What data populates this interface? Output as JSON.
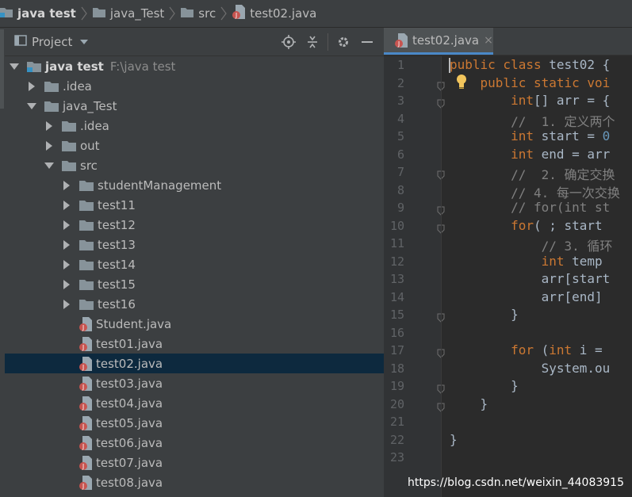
{
  "breadcrumb": {
    "project": "java test",
    "module": "java_Test",
    "folder": "src",
    "file": "test02.java"
  },
  "project_panel": {
    "title": "Project",
    "tree": [
      {
        "label": "java test",
        "hint": "F:\\java test",
        "depth": 0,
        "expanded": true,
        "icon": "project-folder-icon",
        "bold": true
      },
      {
        "label": ".idea",
        "depth": 1,
        "expanded": false,
        "icon": "folder-icon"
      },
      {
        "label": "java_Test",
        "depth": 1,
        "expanded": true,
        "icon": "folder-icon"
      },
      {
        "label": ".idea",
        "depth": 2,
        "expanded": false,
        "icon": "folder-icon"
      },
      {
        "label": "out",
        "depth": 2,
        "expanded": false,
        "icon": "folder-icon"
      },
      {
        "label": "src",
        "depth": 2,
        "expanded": true,
        "icon": "folder-icon"
      },
      {
        "label": "studentManagement",
        "depth": 3,
        "expanded": false,
        "icon": "folder-icon"
      },
      {
        "label": "test11",
        "depth": 3,
        "expanded": false,
        "icon": "folder-icon"
      },
      {
        "label": "test12",
        "depth": 3,
        "expanded": false,
        "icon": "folder-icon"
      },
      {
        "label": "test13",
        "depth": 3,
        "expanded": false,
        "icon": "folder-icon"
      },
      {
        "label": "test14",
        "depth": 3,
        "expanded": false,
        "icon": "folder-icon"
      },
      {
        "label": "test15",
        "depth": 3,
        "expanded": false,
        "icon": "folder-icon"
      },
      {
        "label": "test16",
        "depth": 3,
        "expanded": false,
        "icon": "folder-icon"
      },
      {
        "label": "Student.java",
        "depth": 3,
        "icon": "java-file-icon"
      },
      {
        "label": "test01.java",
        "depth": 3,
        "icon": "java-file-icon"
      },
      {
        "label": "test02.java",
        "depth": 3,
        "icon": "java-file-icon",
        "selected": true
      },
      {
        "label": "test03.java",
        "depth": 3,
        "icon": "java-file-icon"
      },
      {
        "label": "test04.java",
        "depth": 3,
        "icon": "java-file-icon"
      },
      {
        "label": "test05.java",
        "depth": 3,
        "icon": "java-file-icon"
      },
      {
        "label": "test06.java",
        "depth": 3,
        "icon": "java-file-icon"
      },
      {
        "label": "test07.java",
        "depth": 3,
        "icon": "java-file-icon"
      },
      {
        "label": "test08.java",
        "depth": 3,
        "icon": "java-file-icon"
      }
    ]
  },
  "editor": {
    "tab_label": "test02.java",
    "tab_close": "×",
    "line_numbers": [
      "1",
      "2",
      "3",
      "4",
      "5",
      "6",
      "7",
      "8",
      "9",
      "10",
      "11",
      "12",
      "13",
      "14",
      "15",
      "16",
      "17",
      "18",
      "19",
      "20",
      "21",
      "22",
      "23"
    ],
    "lines": [
      [
        {
          "t": "public class ",
          "c": "kw"
        },
        {
          "t": "test02 {",
          "c": ""
        }
      ],
      [
        {
          "t": "    public static voi",
          "c": "kw"
        }
      ],
      [
        {
          "t": "        ",
          "c": ""
        },
        {
          "t": "int",
          "c": "kw"
        },
        {
          "t": "[] arr = {",
          "c": ""
        }
      ],
      [
        {
          "t": "        //  1. 定义两个",
          "c": "cm"
        }
      ],
      [
        {
          "t": "        ",
          "c": ""
        },
        {
          "t": "int",
          "c": "kw"
        },
        {
          "t": " start = ",
          "c": ""
        },
        {
          "t": "0",
          "c": "num"
        }
      ],
      [
        {
          "t": "        ",
          "c": ""
        },
        {
          "t": "int",
          "c": "kw"
        },
        {
          "t": " end = arr",
          "c": ""
        }
      ],
      [
        {
          "t": "        //  2. 确定交换",
          "c": "cm"
        }
      ],
      [
        {
          "t": "        // 4. 每一次交换",
          "c": "cm"
        }
      ],
      [
        {
          "t": "        // for(int st",
          "c": "cm"
        }
      ],
      [
        {
          "t": "        ",
          "c": ""
        },
        {
          "t": "for",
          "c": "kw"
        },
        {
          "t": "( ; start ",
          "c": ""
        }
      ],
      [
        {
          "t": "            // 3. 循环",
          "c": "cm"
        }
      ],
      [
        {
          "t": "            ",
          "c": ""
        },
        {
          "t": "int",
          "c": "kw"
        },
        {
          "t": " temp ",
          "c": ""
        }
      ],
      [
        {
          "t": "            arr[start",
          "c": ""
        }
      ],
      [
        {
          "t": "            arr[end] ",
          "c": ""
        }
      ],
      [
        {
          "t": "        }",
          "c": ""
        }
      ],
      [
        {
          "t": "",
          "c": ""
        }
      ],
      [
        {
          "t": "        ",
          "c": ""
        },
        {
          "t": "for",
          "c": "kw"
        },
        {
          "t": " (",
          "c": ""
        },
        {
          "t": "int",
          "c": "kw"
        },
        {
          "t": " i = ",
          "c": ""
        }
      ],
      [
        {
          "t": "            System.ou",
          "c": ""
        }
      ],
      [
        {
          "t": "        }",
          "c": ""
        }
      ],
      [
        {
          "t": "    }",
          "c": ""
        }
      ],
      [
        {
          "t": "",
          "c": ""
        }
      ],
      [
        {
          "t": "}",
          "c": ""
        }
      ],
      [
        {
          "t": "",
          "c": ""
        }
      ]
    ],
    "fold_lines": [
      2,
      3,
      7,
      9,
      10,
      15,
      17,
      19,
      20
    ]
  },
  "watermark": "https://blog.csdn.net/weixin_44083915",
  "colors": {
    "keyword": "#cc7832",
    "comment": "#808080",
    "number": "#6897bb",
    "selection": "#0d293e",
    "folder": "#87939a",
    "bulb": "#f2c55c"
  }
}
